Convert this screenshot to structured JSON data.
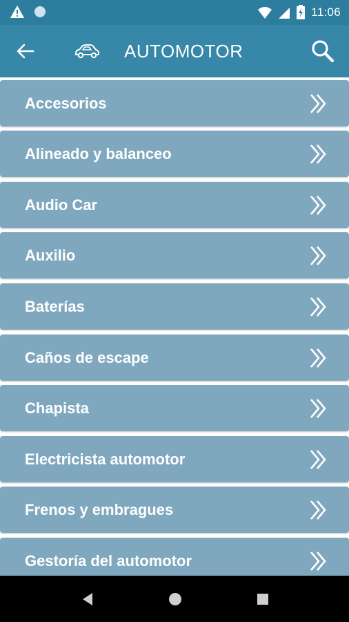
{
  "status_bar": {
    "time": "11:06",
    "icons": [
      "warning-icon",
      "circle-icon",
      "wifi-icon",
      "signal-icon",
      "battery-charging-icon"
    ]
  },
  "app_bar": {
    "title": "AUTOMOTOR",
    "icons": [
      "back-arrow-icon",
      "car-icon",
      "search-icon"
    ]
  },
  "colors": {
    "status_bar": "#2c7d9e",
    "app_bar": "#3687a8",
    "list_item": "#7fa8bf",
    "text": "#ffffff",
    "nav_bar": "#000000"
  },
  "list": {
    "items": [
      {
        "label": "Accesorios"
      },
      {
        "label": "Alineado y balanceo"
      },
      {
        "label": "Audio Car"
      },
      {
        "label": "Auxilio"
      },
      {
        "label": "Baterías"
      },
      {
        "label": "Caños de escape"
      },
      {
        "label": "Chapista"
      },
      {
        "label": "Electricista automotor"
      },
      {
        "label": "Frenos y embragues"
      },
      {
        "label": "Gestoría del automotor"
      }
    ]
  },
  "nav_bar": {
    "icons": [
      "nav-back-icon",
      "nav-home-icon",
      "nav-recents-icon"
    ]
  }
}
